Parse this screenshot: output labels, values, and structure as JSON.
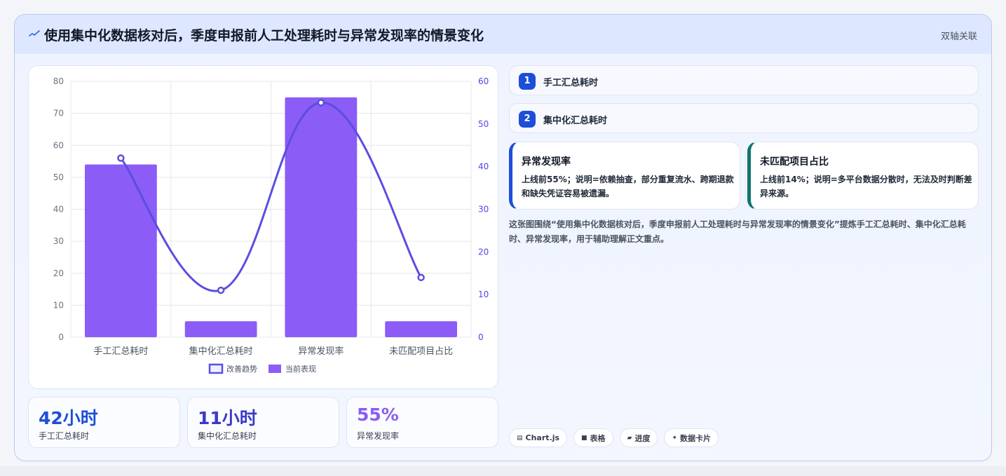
{
  "header": {
    "title": "使用集中化数据核对后，季度申报前人工处理耗时与异常发现率的情景变化",
    "right_label": "双轴关联",
    "icon": "sparkline-icon"
  },
  "chart_data": {
    "type": "bar",
    "categories": [
      "手工汇总耗时",
      "集中化汇总耗时",
      "异常发现率",
      "未匹配项目占比"
    ],
    "series": [
      {
        "name": "当前表现",
        "type": "bar",
        "axis": "left",
        "values": [
          54,
          5,
          75,
          5
        ],
        "color": "#8b5cf6"
      },
      {
        "name": "改善趋势",
        "type": "line",
        "axis": "right",
        "values": [
          42,
          11,
          55,
          14
        ],
        "color": "#5b4ee0"
      }
    ],
    "legend_order": [
      "改善趋势",
      "当前表现"
    ],
    "ylim_left": [
      0,
      80
    ],
    "yticks_left": [
      0,
      10,
      20,
      30,
      40,
      50,
      60,
      70,
      80
    ],
    "ylim_right": [
      0,
      60
    ],
    "yticks_right": [
      0,
      10,
      20,
      30,
      40,
      50,
      60
    ],
    "grid": true,
    "legend_position": "bottom"
  },
  "kpis": [
    {
      "value": "42小时",
      "label": "手工汇总耗时",
      "color": "#1d4ed8"
    },
    {
      "value": "11小时",
      "label": "集中化汇总耗时",
      "color": "#3b38c9"
    },
    {
      "value": "55%",
      "label": "异常发现率",
      "color": "#8b5cf6"
    }
  ],
  "steps": [
    {
      "num": "1",
      "label": "手工汇总耗时"
    },
    {
      "num": "2",
      "label": "集中化汇总耗时"
    }
  ],
  "info_cards": [
    {
      "title": "异常发现率",
      "body": "上线前55%；说明=依赖抽查，部分重复流水、跨期退款和缺失凭证容易被遗漏。",
      "accent": "#1d4ed8"
    },
    {
      "title": "未匹配项目占比",
      "body": "上线前14%；说明=多平台数据分散时，无法及时判断差异来源。",
      "accent": "#0f766e"
    }
  ],
  "description": "这张图围绕“使用集中化数据核对后，季度申报前人工处理耗时与异常发现率的情景变化”提炼手工汇总耗时、集中化汇总耗时、异常发现率，用于辅助理解正文重点。",
  "tags": [
    {
      "icon": "▤",
      "label": "Chart.js"
    },
    {
      "icon": "■",
      "label": "表格"
    },
    {
      "icon": "▰",
      "label": "进度"
    },
    {
      "icon": "✦",
      "label": "数据卡片"
    }
  ]
}
